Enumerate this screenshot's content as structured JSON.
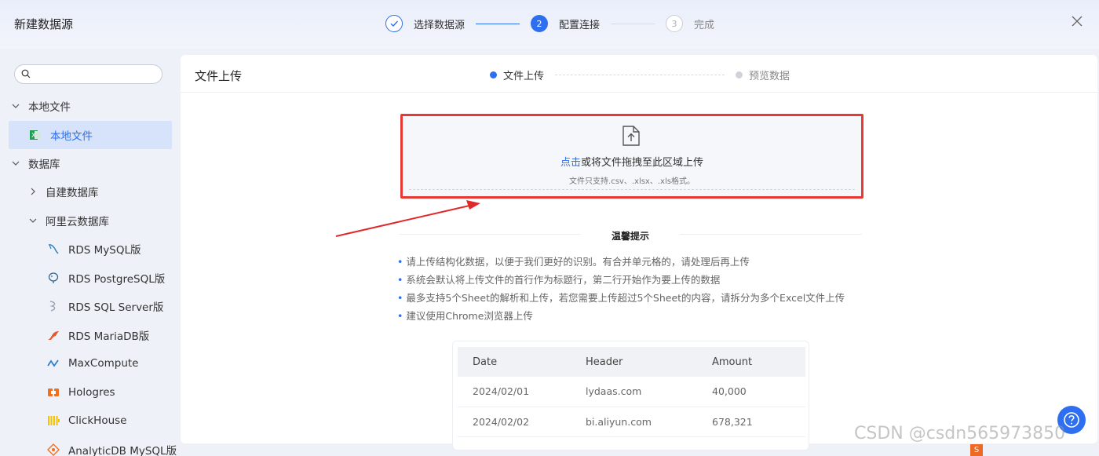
{
  "dialog": {
    "title": "新建数据源"
  },
  "steps": [
    {
      "index": "",
      "label": "选择数据源",
      "state": "done"
    },
    {
      "index": "2",
      "label": "配置连接",
      "state": "active"
    },
    {
      "index": "3",
      "label": "完成",
      "state": "pending"
    }
  ],
  "sidebar": {
    "search": {
      "placeholder": "",
      "value": ""
    },
    "tree": [
      {
        "label": "本地文件",
        "type": "group",
        "expanded": true
      },
      {
        "label": "本地文件",
        "type": "leaf",
        "icon": "excel-icon",
        "selected": true
      },
      {
        "label": "数据库",
        "type": "group",
        "expanded": true
      },
      {
        "label": "自建数据库",
        "type": "subgroup",
        "expanded": false
      },
      {
        "label": "阿里云数据库",
        "type": "subgroup",
        "expanded": true
      },
      {
        "label": "RDS MySQL版",
        "type": "leaf",
        "icon": "mysql-icon"
      },
      {
        "label": "RDS PostgreSQL版",
        "type": "leaf",
        "icon": "postgresql-icon"
      },
      {
        "label": "RDS SQL Server版",
        "type": "leaf",
        "icon": "sqlserver-icon"
      },
      {
        "label": "RDS MariaDB版",
        "type": "leaf",
        "icon": "mariadb-icon"
      },
      {
        "label": "MaxCompute",
        "type": "leaf",
        "icon": "maxcompute-icon"
      },
      {
        "label": "Hologres",
        "type": "leaf",
        "icon": "hologres-icon"
      },
      {
        "label": "ClickHouse",
        "type": "leaf",
        "icon": "clickhouse-icon"
      },
      {
        "label": "AnalyticDB MySQL版",
        "type": "leaf",
        "icon": "analyticdb-icon"
      }
    ]
  },
  "main": {
    "title": "文件上传",
    "substeps": [
      {
        "label": "文件上传",
        "state": "active"
      },
      {
        "label": "预览数据",
        "state": "pending"
      }
    ],
    "upload": {
      "link_text": "点击",
      "text": "或将文件拖拽至此区域上传",
      "hint": "文件只支持.csv、.xlsx、.xls格式。"
    },
    "tips": {
      "title": "温馨提示",
      "items": [
        "请上传结构化数据，以便于我们更好的识别。有合并单元格的，请处理后再上传",
        "系统会默认将上传文件的首行作为标题行，第二行开始作为要上传的数据",
        "最多支持5个Sheet的解析和上传，若您需要上传超过5个Sheet的内容，请拆分为多个Excel文件上传",
        "建议使用Chrome浏览器上传"
      ]
    },
    "sample_table": {
      "columns": [
        "Date",
        "Header",
        "Amount"
      ],
      "rows": [
        [
          "2024/02/01",
          "lydaas.com",
          "40,000"
        ],
        [
          "2024/02/02",
          "bi.aliyun.com",
          "678,321"
        ]
      ]
    }
  },
  "watermark": "CSDN @csdn565973850",
  "colors": {
    "accent": "#2d6ff0",
    "highlight": "#e53935"
  }
}
